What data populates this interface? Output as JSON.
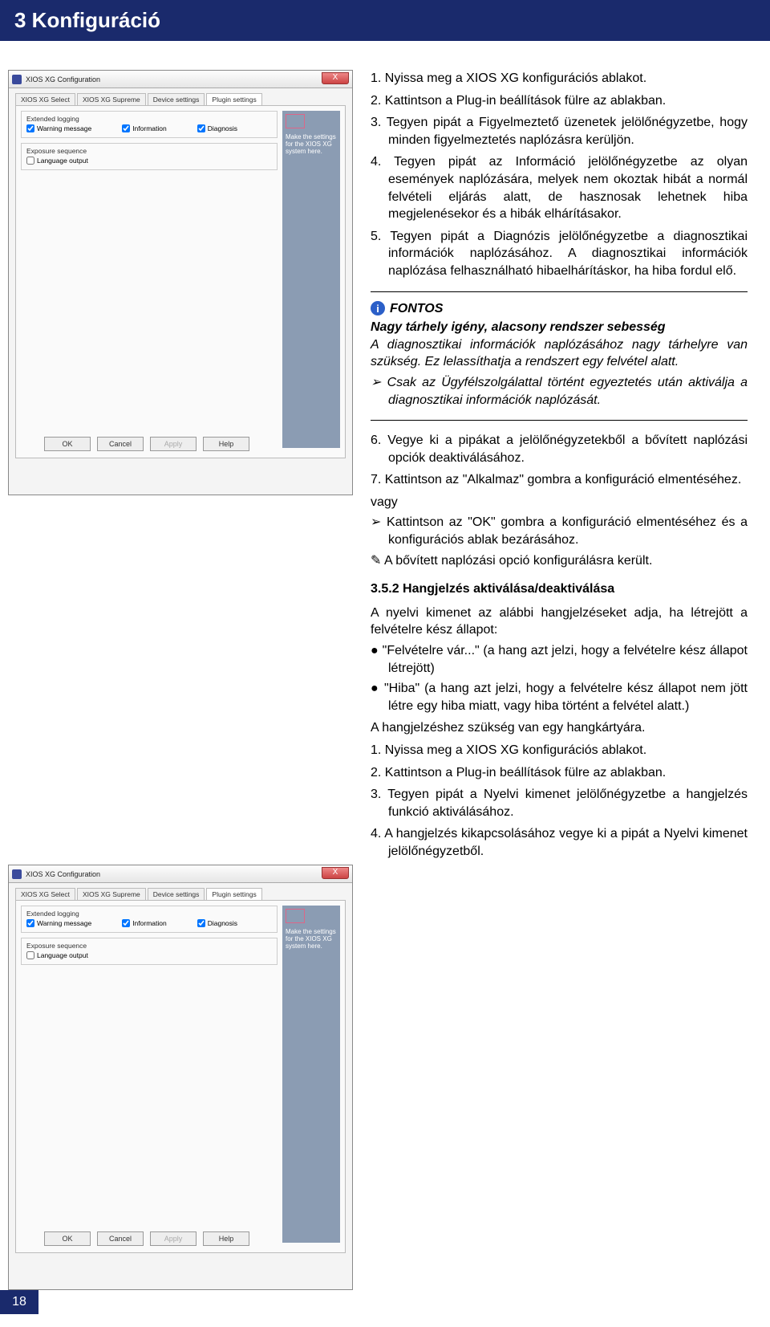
{
  "header": {
    "title": "3 Konfiguráció"
  },
  "window": {
    "title": "XIOS XG Configuration",
    "close": "X",
    "tabs": [
      "XIOS XG Select",
      "XIOS XG Supreme",
      "Device settings",
      "Plugin settings"
    ],
    "fieldset1": {
      "legend": "Extended logging",
      "chk_warning": "Warning message",
      "chk_diagnosis": "Diagnosis",
      "chk_information": "Information"
    },
    "fieldset2": {
      "legend": "Exposure sequence",
      "chk_language": "Language output"
    },
    "rightpanel": "Make the settings for the XIOS XG system here.",
    "buttons": {
      "ok": "OK",
      "cancel": "Cancel",
      "apply": "Apply",
      "help": "Help"
    }
  },
  "steps": {
    "s1": "1.  Nyissa meg a XIOS XG konfigurációs ablakot.",
    "s2": "2.  Kattintson a Plug-in beállítások fülre az ablakban.",
    "s3": "3.  Tegyen pipát a Figyelmeztető üzenetek jelölőnégyzetbe, hogy minden figyelmeztetés naplózásra kerüljön.",
    "s4": "4.  Tegyen pipát az Információ jelölőnégyzetbe az olyan események naplózására, melyek nem okoztak hibát a normál felvételi eljárás alatt, de hasznosak lehetnek hiba megjelenésekor és a hibák elhárításakor.",
    "s5": "5.  Tegyen pipát a Diagnózis jelölőnégyzetbe a diagnosztikai információk naplózásához. A diagnosztikai információk naplózása felhasználható hibaelhárításkor, ha hiba fordul elő."
  },
  "note": {
    "label": "FONTOS",
    "bold": "Nagy tárhely igény, alacsony rendszer sebesség",
    "body": "A diagnosztikai információk naplózásához nagy tárhelyre van szükség. Ez lelassíthatja a rendszert egy felvétel alatt.",
    "arrow": "➢  Csak az Ügyfélszolgálattal történt egyeztetés után aktiválja a diagnosztikai információk naplózását."
  },
  "steps2": {
    "s6": "6.  Vegye ki a pipákat a jelölőnégyzetekből a bővített naplózási opciók deaktiválásához.",
    "s7": "7.  Kattintson az \"Alkalmaz\" gombra a konfiguráció elmentéséhez.",
    "vagy": "vagy",
    "arrow1": "➢  Kattintson az \"OK\" gombra a konfiguráció elmentéséhez és a konfigurációs ablak bezárásához.",
    "hand": "✎  A bővített naplózási opció konfigurálásra került."
  },
  "subhead": "3.5.2    Hangjelzés aktiválása/deaktiválása",
  "section2": {
    "intro": "A nyelvi kimenet az alábbi hangjelzéseket adja, ha létrejött a felvételre kész állapot:",
    "b1": "●  \"Felvételre vár...\" (a hang azt jelzi, hogy a felvételre kész állapot létrejött)",
    "b2": "●  \"Hiba\" (a hang azt jelzi, hogy a felvételre kész állapot nem jött létre egy hiba miatt, vagy hiba történt a felvétel alatt.)",
    "need": "A hangjelzéshez szükség van egy hangkártyára.",
    "s1": "1.  Nyissa meg a XIOS XG konfigurációs ablakot.",
    "s2": "2.  Kattintson a Plug-in beállítások fülre az ablakban.",
    "s3": "3.  Tegyen pipát a Nyelvi kimenet jelölőnégyzetbe a hangjelzés funkció aktiválásához.",
    "s4": "4.  A hangjelzés kikapcsolásához vegye ki a pipát a Nyelvi kimenet jelölőnégyzetből."
  },
  "pagenum": "18"
}
